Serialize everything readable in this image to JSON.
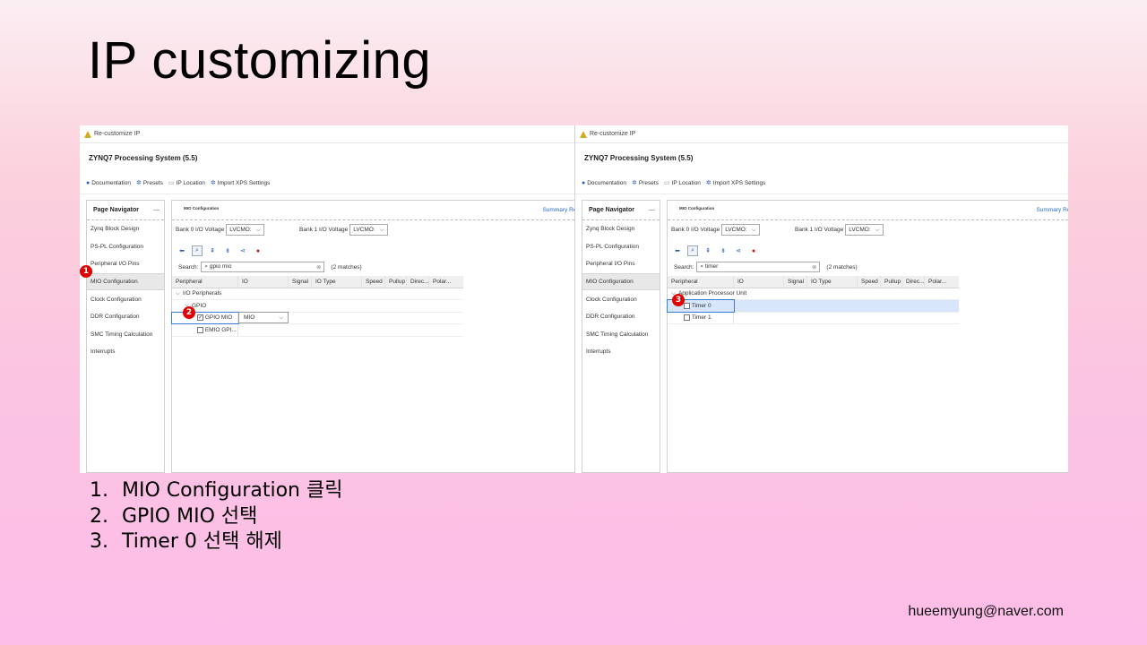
{
  "slide": {
    "title": "IP customizing",
    "notes": [
      {
        "num": "1.",
        "text": "MIO Configuration 클릭"
      },
      {
        "num": "2.",
        "text": "GPIO MIO 선택"
      },
      {
        "num": "3.",
        "text": "Timer 0 선택 해제"
      }
    ],
    "email": "hueemyung@naver.com"
  },
  "common": {
    "window_title": "Re-customize IP",
    "ip_name": "ZYNQ7 Processing System (5.5)",
    "toolbar": [
      "Documentation",
      "Presets",
      "IP Location",
      "Import XPS Settings"
    ],
    "nav_title": "Page Navigator",
    "nav_collapse": "—",
    "nav_items": [
      "Zynq Block Design",
      "PS-PL Configuration",
      "Peripheral I/O Pins",
      "MIO Configuration",
      "Clock Configuration",
      "DDR Configuration",
      "SMC Timing Calculation",
      "Interrupts"
    ],
    "main_title": "MIO Configuration",
    "summary_link": "Summary Rep",
    "bank0_label": "Bank 0 I/O Voltage",
    "bank0_value": "LVCMO:",
    "bank1_label": "Bank 1 I/O Voltage",
    "bank1_value": "LVCMO:",
    "search_label": "Search:",
    "columns": [
      "Peripheral",
      "IO",
      "Signal",
      "IO Type",
      "Speed",
      "Pullup",
      "Direc...",
      "Polar..."
    ]
  },
  "left": {
    "search_value": "gpio mio",
    "matches": "(2 matches)",
    "tree": {
      "group": "I/O Peripherals",
      "sub": "GPIO",
      "item1": "GPIO MIO",
      "item1_io": "MIO",
      "item1_checked": true,
      "item2": "EMIO GPI..."
    },
    "badges": [
      "1",
      "2"
    ]
  },
  "right": {
    "search_value": "timer",
    "matches": "(2 matches)",
    "tree": {
      "group": "Application Processor Unit",
      "item1": "Timer 0",
      "item2": "Timer 1"
    },
    "badge": "3"
  },
  "colors": {
    "badge": "#e00000",
    "link": "#2a6ad6",
    "row_highlight": "#d7e6fb"
  }
}
